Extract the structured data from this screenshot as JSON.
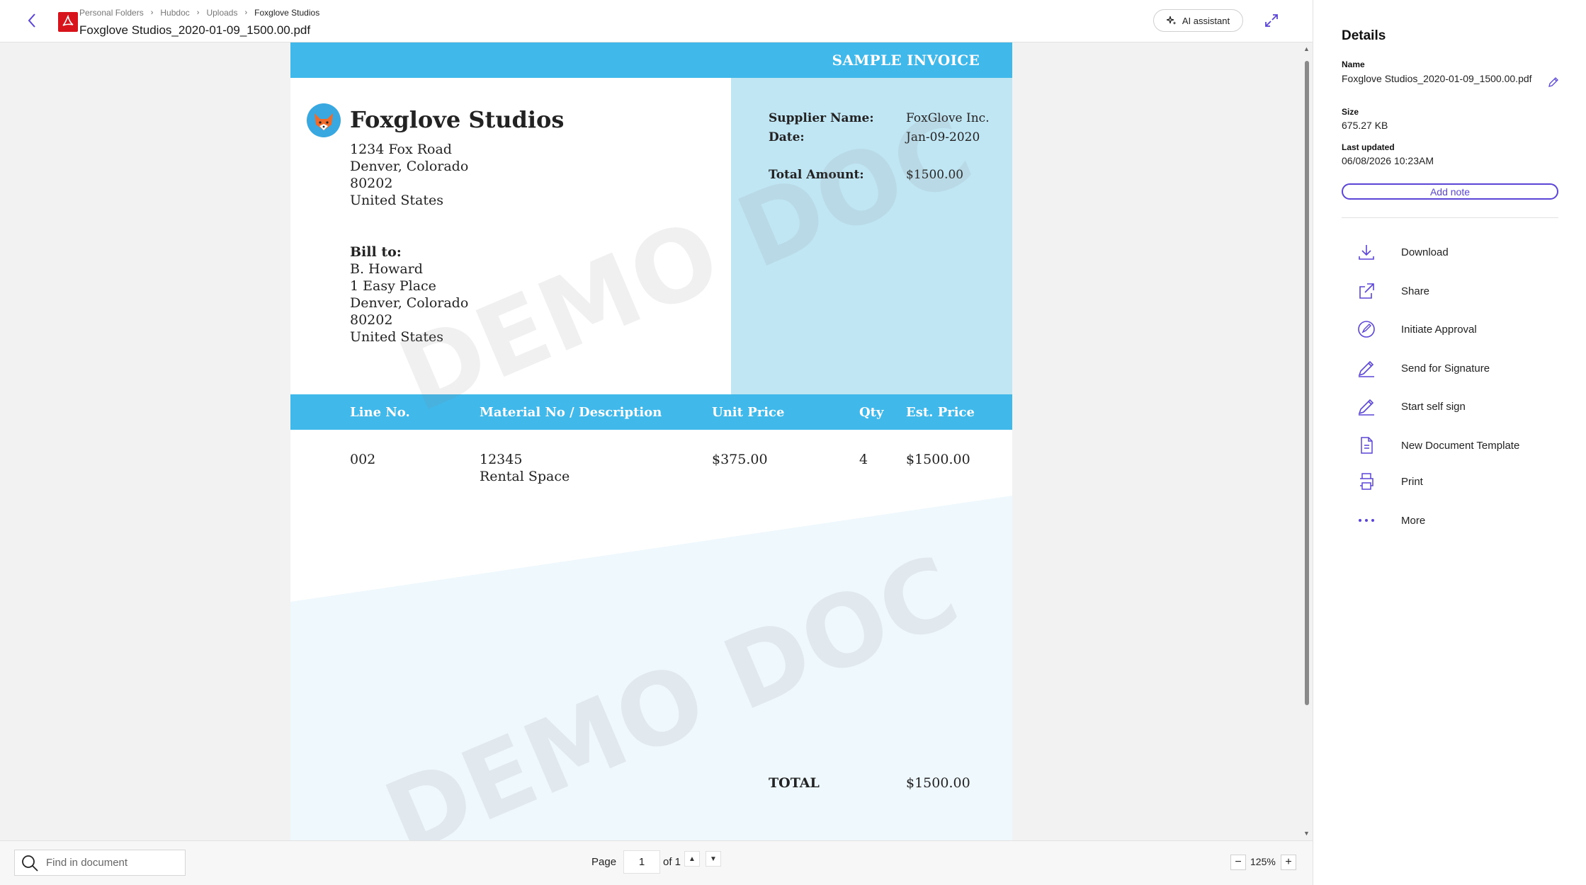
{
  "header": {
    "breadcrumb": [
      "Personal Folders",
      "Hubdoc",
      "Uploads",
      "Foxglove Studios"
    ],
    "file_name": "Foxglove Studios_2020-01-09_1500.00.pdf",
    "ai_assistant_label": "AI assistant"
  },
  "document": {
    "banner_title": "SAMPLE INVOICE",
    "company_name": "Foxglove Studios",
    "company_address": [
      "1234 Fox Road",
      "Denver, Colorado",
      "80202",
      "United States"
    ],
    "bill_to_label": "Bill to:",
    "bill_to_address": [
      "B. Howard",
      "1 Easy Place",
      "Denver, Colorado",
      "80202",
      "United States"
    ],
    "summary": {
      "supplier_label": "Supplier Name:",
      "supplier_value": "FoxGlove Inc.",
      "date_label": "Date:",
      "date_value": "Jan-09-2020",
      "total_label": "Total Amount:",
      "total_value": "$1500.00"
    },
    "table": {
      "columns": [
        "Line No.",
        "Material No / Description",
        "Unit Price",
        "Qty",
        "Est. Price"
      ],
      "rows": [
        {
          "line_no": "002",
          "material_no": "12345",
          "description": "Rental Space",
          "unit_price": "$375.00",
          "qty": "4",
          "est_price": "$1500.00"
        }
      ]
    },
    "total_label": "TOTAL",
    "total_value": "$1500.00",
    "watermark": "DEMO DOC"
  },
  "toolbar": {
    "find_placeholder": "Find in document",
    "page_label": "Page",
    "page_current": "1",
    "page_of": "of 1",
    "zoom_level": "125%"
  },
  "details": {
    "title": "Details",
    "name_label": "Name",
    "name_value": "Foxglove Studios_2020-01-09_1500.00.pdf",
    "size_label": "Size",
    "size_value": "675.27 KB",
    "updated_label": "Last updated",
    "updated_value": "06/08/2026 10:23AM",
    "add_note_label": "Add note",
    "actions": [
      {
        "label": "Download",
        "icon": "download-icon"
      },
      {
        "label": "Share",
        "icon": "share-icon"
      },
      {
        "label": "Initiate Approval",
        "icon": "approval-icon"
      },
      {
        "label": "Send for Signature",
        "icon": "signature-pen-icon"
      },
      {
        "label": "Start self sign",
        "icon": "self-sign-pen-icon"
      },
      {
        "label": "New Document Template",
        "icon": "document-template-icon"
      },
      {
        "label": "Print",
        "icon": "printer-icon"
      },
      {
        "label": "More",
        "icon": "more-dots-icon"
      }
    ]
  },
  "colors": {
    "accent": "#5a45d6",
    "invoice_blue": "#40b8ea",
    "invoice_light_blue": "#c0e5f3",
    "pdf_red": "#d7141b"
  }
}
